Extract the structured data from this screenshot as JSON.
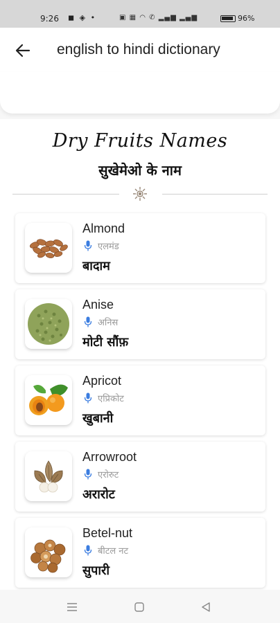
{
  "status_bar": {
    "time": "9:26",
    "left_icons": "◼ ◈ •",
    "right_icons": "▣ ▦ ◠ ✆ ▂▄▆ ▂▄▆",
    "battery_text": "96%"
  },
  "app_bar": {
    "title": "english to hindi dictionary",
    "back_icon": "arrow-left"
  },
  "section": {
    "title": "Dry Fruits Names",
    "subtitle": "सुखेमेओ के नाम"
  },
  "items": [
    {
      "english": "Almond",
      "pronunciation": "एलमंड",
      "hindi": "बादाम",
      "image": "almonds"
    },
    {
      "english": "Anise",
      "pronunciation": "अनिस",
      "hindi": "मोटी सौंफ़",
      "image": "anise"
    },
    {
      "english": "Apricot",
      "pronunciation": "एप्रिकोट",
      "hindi": "खुबानी",
      "image": "apricot"
    },
    {
      "english": "Arrowroot",
      "pronunciation": "एरोरुट",
      "hindi": "अरारोट",
      "image": "arrowroot"
    },
    {
      "english": "Betel-nut",
      "pronunciation": "बीटल नट",
      "hindi": "सुपारी",
      "image": "betel-nut"
    }
  ],
  "colors": {
    "mic": "#3b7de0",
    "status_bar_bg": "#d7d7d7",
    "divider": "#cfcfcf"
  },
  "nav": {
    "menu_icon": "menu-icon",
    "home_icon": "home-square-icon",
    "back_icon": "back-triangle-icon"
  }
}
